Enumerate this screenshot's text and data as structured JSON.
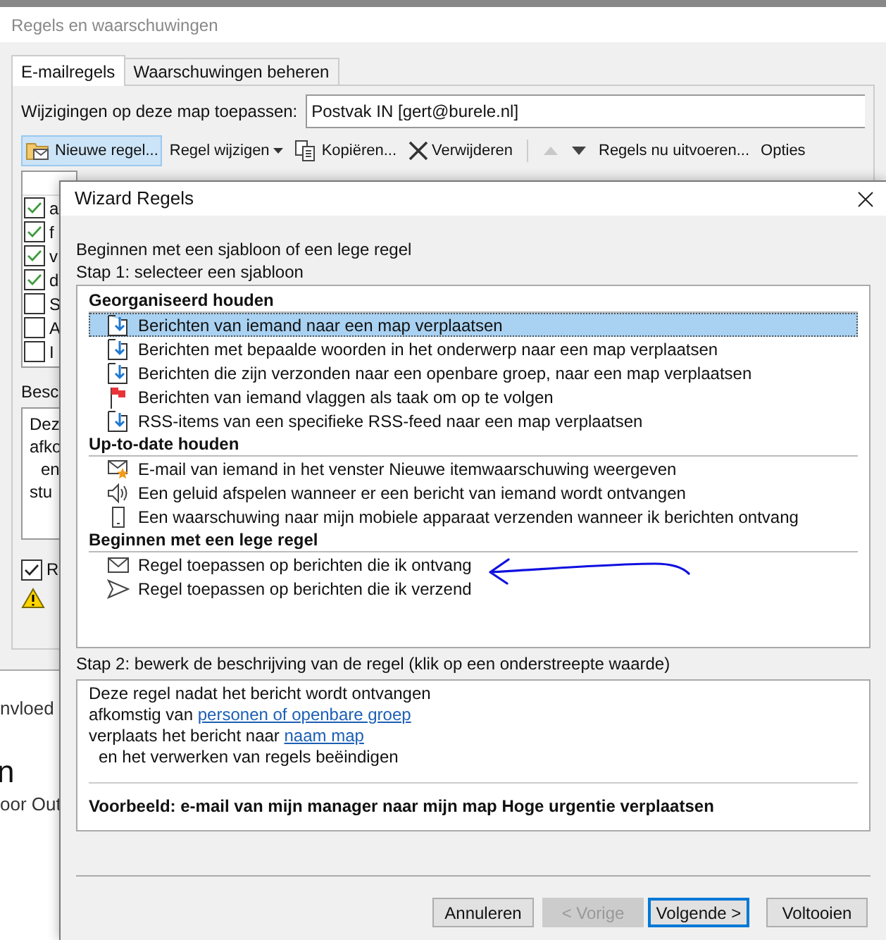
{
  "rules_window": {
    "title": "Regels en waarschuwingen",
    "tabs": [
      {
        "label": "E-mailregels",
        "selected": true
      },
      {
        "label": "Waarschuwingen beheren",
        "selected": false
      }
    ],
    "folder_field": {
      "label": "Wijzigingen op deze map toepassen:",
      "value": "Postvak IN [gert@burele.nl]"
    },
    "toolbar": [
      {
        "kind": "new",
        "label": "Nieuwe regel...",
        "selected": true
      },
      {
        "kind": "dropdown",
        "label": "Regel wijzigen",
        "selected": false
      },
      {
        "kind": "copy",
        "label": "Kopiëren...",
        "selected": false
      },
      {
        "kind": "delete",
        "label": "Verwijderen",
        "selected": false
      },
      {
        "kind": "separator"
      },
      {
        "kind": "up",
        "disabled": true
      },
      {
        "kind": "down",
        "disabled": false
      },
      {
        "kind": "text",
        "label": "Regels nu uitvoeren...",
        "selected": false
      },
      {
        "kind": "text",
        "label": "Opties",
        "selected": false
      }
    ],
    "rules": [
      {
        "text": "a",
        "checked": true
      },
      {
        "text": "f",
        "checked": true
      },
      {
        "text": "v",
        "checked": true
      },
      {
        "text": "d",
        "checked": true
      },
      {
        "text": "S",
        "checked": false
      },
      {
        "text": "A",
        "checked": false
      },
      {
        "text": "I",
        "checked": false
      }
    ],
    "description_label": "Besc",
    "description_lines": [
      "Dez",
      "afko",
      "en",
      "stu"
    ],
    "option": {
      "label": "R",
      "checked": true
    }
  },
  "outlook_fragments": [
    {
      "kind": "text",
      "text": "nvloed"
    },
    {
      "kind": "heading",
      "text": "n"
    },
    {
      "kind": "text",
      "text": "oor Out"
    }
  ],
  "wizard": {
    "title": "Wizard Regels",
    "intro": "Beginnen met een sjabloon of een lege regel",
    "step1": "Stap 1: selecteer een sjabloon",
    "groups": [
      {
        "heading": "Georganiseerd houden",
        "items": [
          {
            "kind": "move",
            "text": "Berichten van iemand naar een map verplaatsen",
            "selected": true
          },
          {
            "kind": "move",
            "text": "Berichten met bepaalde woorden in het onderwerp naar een map verplaatsen",
            "selected": false
          },
          {
            "kind": "move",
            "text": "Berichten die zijn verzonden naar een openbare groep, naar een map verplaatsen",
            "selected": false
          },
          {
            "kind": "flag",
            "text": "Berichten van iemand vlaggen als taak om op te volgen",
            "selected": false
          },
          {
            "kind": "move",
            "text": "RSS-items van een specifieke RSS-feed naar een map verplaatsen",
            "selected": false
          }
        ]
      },
      {
        "heading": "Up-to-date houden",
        "items": [
          {
            "kind": "alert",
            "text": "E-mail van iemand in het venster Nieuwe itemwaarschuwing weergeven",
            "selected": false
          },
          {
            "kind": "sound",
            "text": "Een geluid afspelen wanneer er een bericht van iemand wordt ontvangen",
            "selected": false
          },
          {
            "kind": "phone",
            "text": "Een waarschuwing naar mijn mobiele apparaat verzenden wanneer ik berichten ontvang",
            "selected": false
          }
        ]
      },
      {
        "heading": "Beginnen met een lege regel",
        "items": [
          {
            "kind": "mail",
            "text": "Regel toepassen op berichten die ik ontvang",
            "selected": false
          },
          {
            "kind": "send",
            "text": "Regel toepassen op berichten die ik verzend",
            "selected": false
          }
        ]
      }
    ],
    "step2": "Stap 2: bewerk de beschrijving van de regel (klik op een onderstreepte waarde)",
    "description": [
      {
        "kind": "plain",
        "parts": [
          {
            "text": "Deze regel nadat het bericht wordt ontvangen",
            "link": false
          }
        ]
      },
      {
        "kind": "plain",
        "parts": [
          {
            "text": "afkomstig van ",
            "link": false
          },
          {
            "text": "personen of openbare groep",
            "link": true
          }
        ]
      },
      {
        "kind": "plain",
        "parts": [
          {
            "text": "verplaats het bericht naar ",
            "link": false
          },
          {
            "text": "naam map",
            "link": true
          }
        ]
      },
      {
        "kind": "indented",
        "parts": [
          {
            "text": "en het verwerken van regels beëindigen",
            "link": false
          }
        ]
      }
    ],
    "example": "Voorbeeld: e-mail van mijn manager naar mijn map Hoge urgentie verplaatsen",
    "buttons": [
      {
        "label": "Annuleren",
        "disabled": false,
        "default": false
      },
      {
        "label": "< Vorige",
        "disabled": true,
        "default": false
      },
      {
        "label": "Volgende >",
        "disabled": false,
        "default": true
      },
      {
        "label": "Voltooien",
        "disabled": false,
        "default": false
      }
    ]
  }
}
